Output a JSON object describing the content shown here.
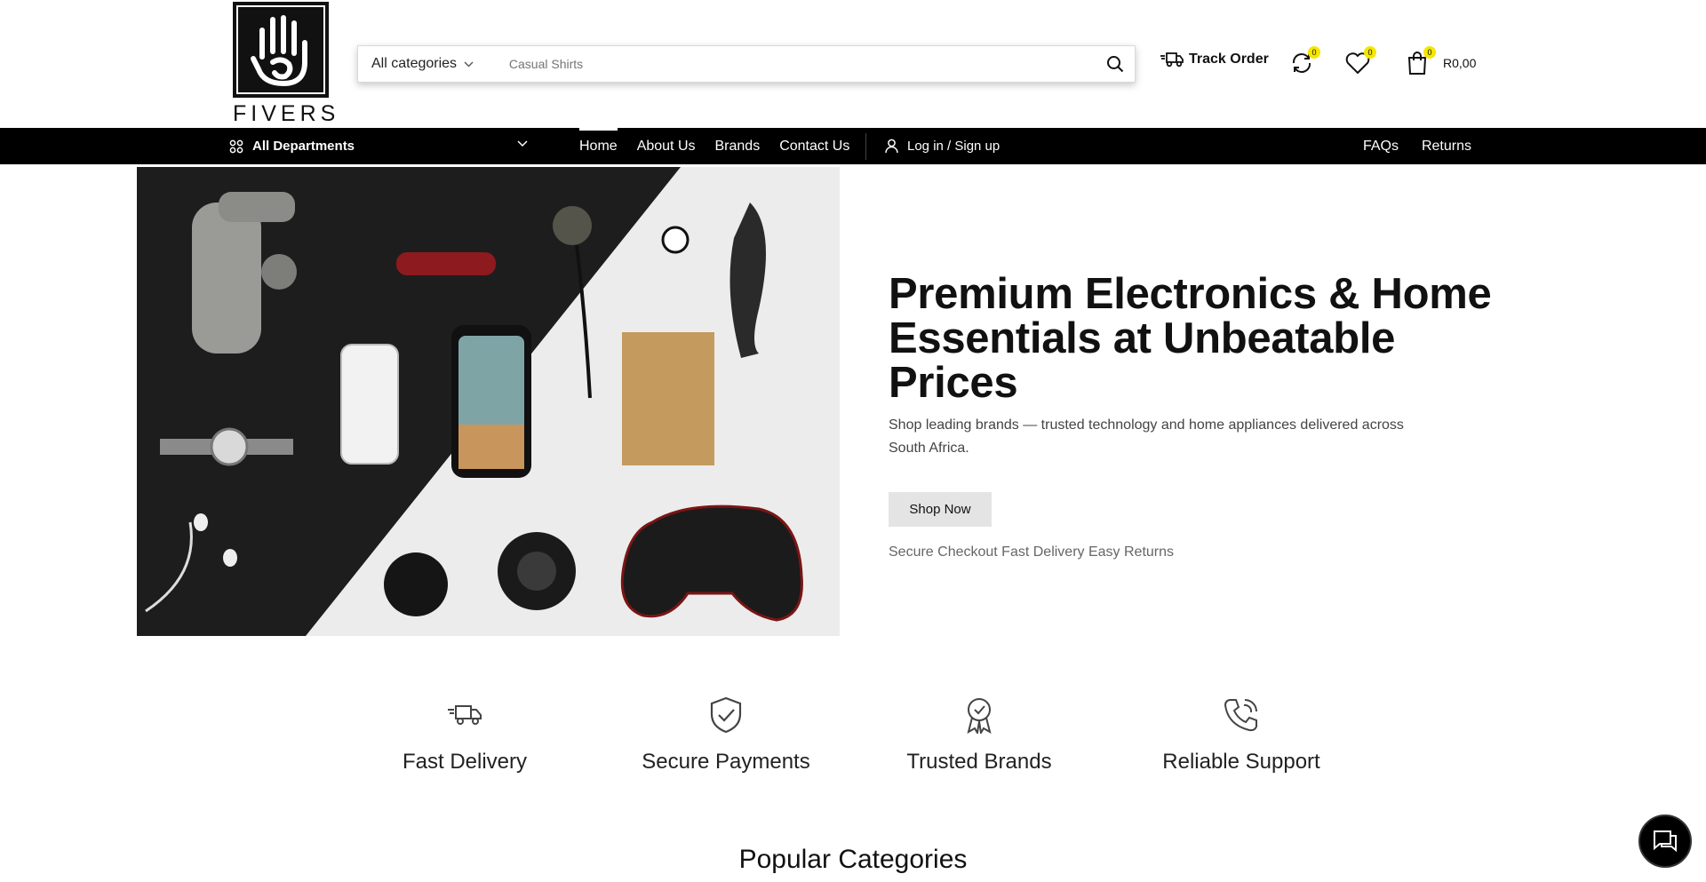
{
  "brand": {
    "name": "FIVERS"
  },
  "search": {
    "category_label": "All categories",
    "placeholder": " Casual Shirts"
  },
  "header": {
    "track_order": "Track Order",
    "compare_count": "0",
    "wishlist_count": "0",
    "cart_count": "0",
    "cart_total": "R0,00"
  },
  "nav": {
    "all_departments": "All Departments",
    "links": [
      "Home",
      "About Us",
      "Brands",
      "Contact Us"
    ],
    "active": "Home",
    "login": "Log in / Sign up",
    "right_links": [
      "FAQs",
      "Returns"
    ]
  },
  "hero": {
    "title": "Premium Electronics & Home Essentials at Unbeatable Prices",
    "subtitle": "Shop leading brands — trusted technology and home appliances delivered across South Africa.",
    "cta": "Shop Now",
    "trust_line": " Secure Checkout  Fast Delivery  Easy Returns"
  },
  "features": [
    {
      "icon": "truck-icon",
      "label": "Fast Delivery"
    },
    {
      "icon": "shield-check-icon",
      "label": "Secure Payments"
    },
    {
      "icon": "award-ribbon-icon",
      "label": "Trusted Brands"
    },
    {
      "icon": "phone-icon",
      "label": "Reliable Support"
    }
  ],
  "sections": {
    "popular_categories": "Popular Categories"
  },
  "colors": {
    "primary": "#000000",
    "badge": "#f5e600",
    "button_bg": "#e4e4e4"
  }
}
